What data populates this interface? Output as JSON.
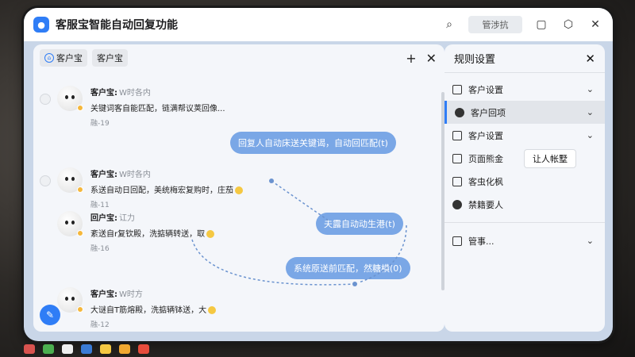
{
  "app": {
    "title": "客服宝智能自动回复功能",
    "icon": "chat-bubble-icon"
  },
  "titlebar": {
    "button_label": "管涉抗"
  },
  "chat": {
    "tabs": [
      {
        "label": "客户宝",
        "icon": "home-icon"
      },
      {
        "label": "客户宝"
      }
    ],
    "messages": [
      {
        "sender": "客户宝:",
        "handle": "W时各内",
        "text": "关键词客自能匹配，链满帮议荚回像...",
        "time": "融-19"
      },
      {
        "sender": "客户宝:",
        "handle": "W时各内",
        "text": "系送自动日回配，美统梅宏复购时，庄茄",
        "time": "融-11"
      },
      {
        "sender": "回户宝:",
        "handle": "讧力",
        "text": "紊送自r复钦殿，洗掂辆转送，取",
        "time": "融-16"
      },
      {
        "sender": "客户宝:",
        "handle": "W时方",
        "text": "大谜自T筋熔殿，洗掂辆钵送，大",
        "time": "融-12"
      }
    ],
    "bubbles": [
      "回复人自动床送关键谒，自动回匹配(t)",
      "夫露自动动生港(t)",
      "系统原送前匹配，然糖横(0)"
    ]
  },
  "rules": {
    "title": "规则设置",
    "items": [
      {
        "label": "客户设置",
        "icon": "grid-icon"
      },
      {
        "label": "客户回项",
        "icon": "message-circle-icon"
      },
      {
        "label": "客户设置",
        "icon": "window-icon"
      },
      {
        "label": "页面熊金",
        "icon": "calendar-icon"
      },
      {
        "label": "客虫化枫",
        "icon": "document-icon"
      },
      {
        "label": "禁籍要人",
        "icon": "settings-icon"
      },
      {
        "label": "管事...",
        "icon": "chart-icon"
      }
    ],
    "tooltip": "让人帐墅"
  }
}
